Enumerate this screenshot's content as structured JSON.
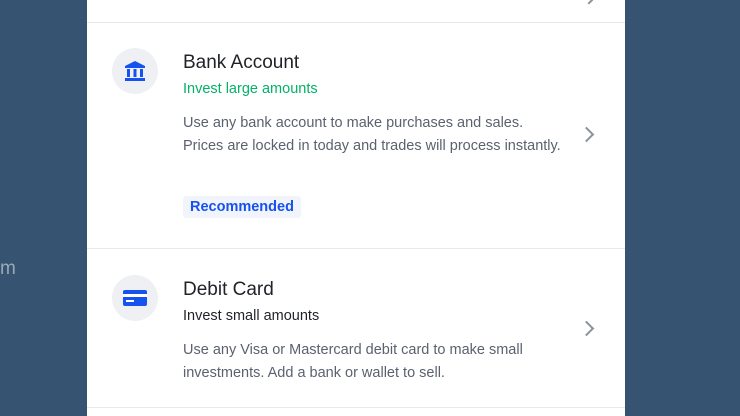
{
  "background": {
    "partial_text": "m"
  },
  "options": [
    {
      "title": "Bank Account",
      "subtitle": "Invest large amounts",
      "description": "Use any bank account to make purchases and sales. Prices are locked in today and trades will process instantly.",
      "badge": "Recommended",
      "icon": "bank-icon"
    },
    {
      "title": "Debit Card",
      "subtitle": "Invest small amounts",
      "description": "Use any Visa or Mastercard debit card to make small investments. Add a bank or wallet to sell.",
      "icon": "credit-card-icon"
    }
  ],
  "colors": {
    "backdrop": "#365472",
    "panel": "#ffffff",
    "accent_blue": "#1652f0",
    "accent_green": "#05b169"
  }
}
